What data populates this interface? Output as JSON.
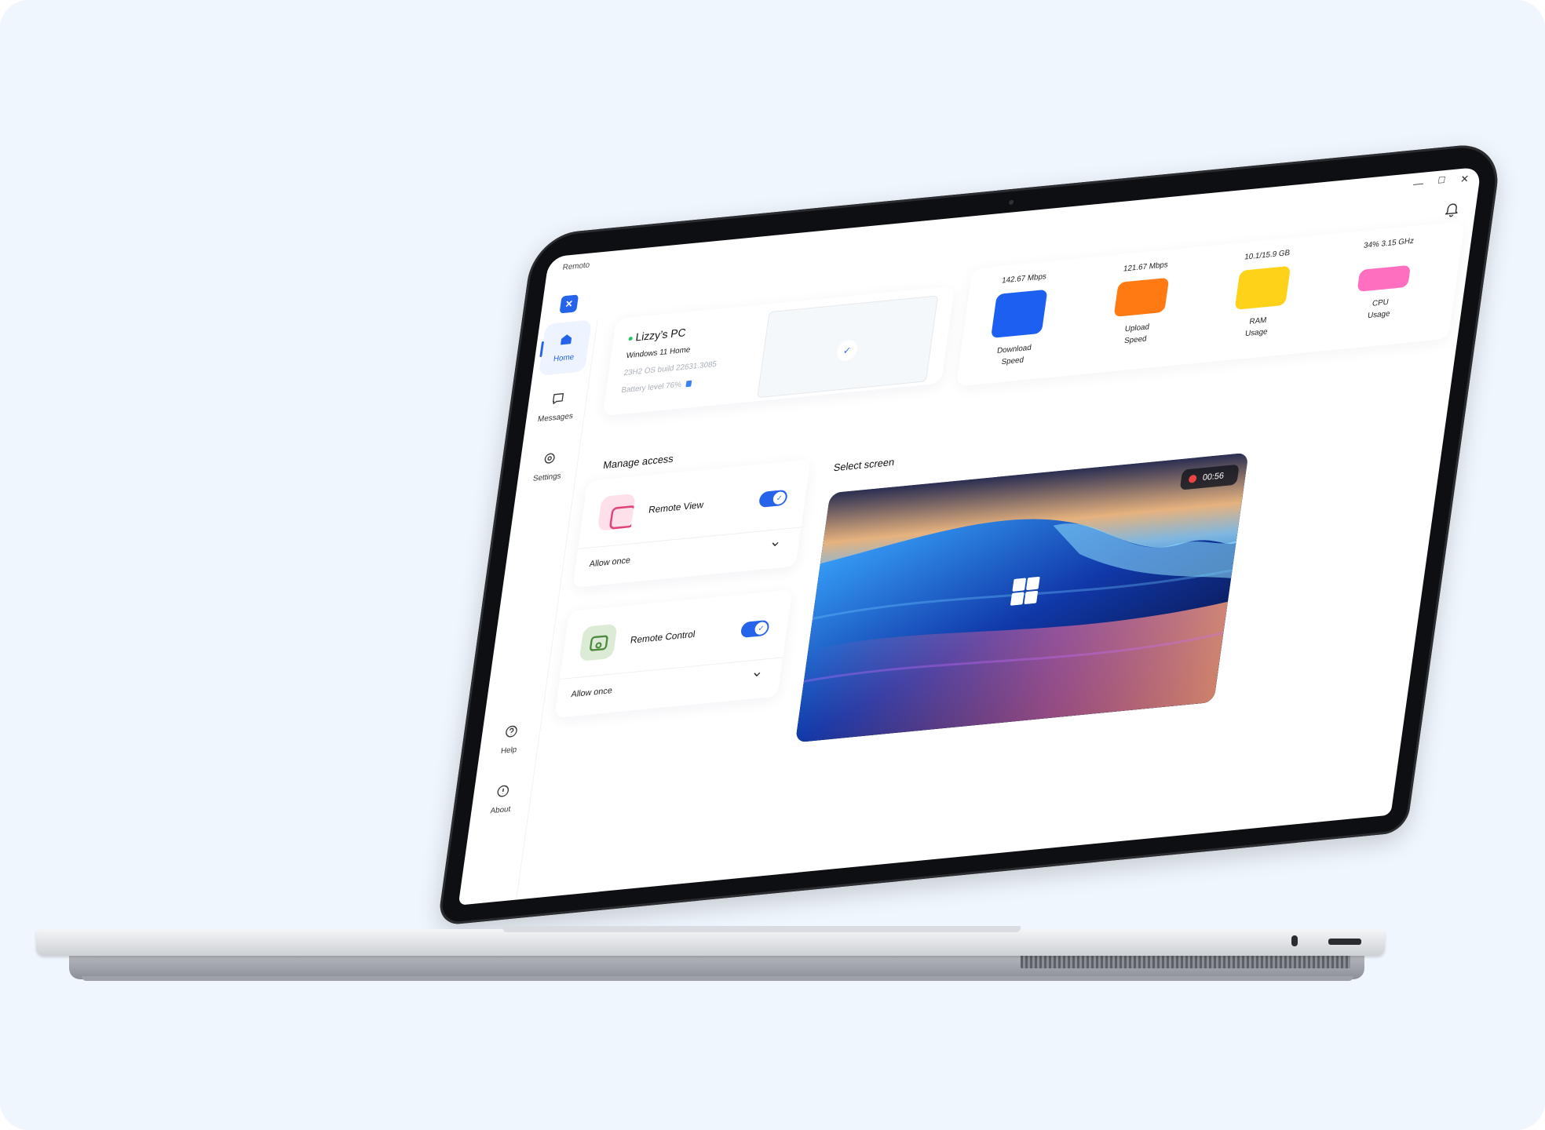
{
  "app": {
    "name": "Remoto",
    "logo_glyph": "✕"
  },
  "window_controls": {
    "minimize": "—",
    "maximize": "☐",
    "close": "✕"
  },
  "sidebar": {
    "items": [
      {
        "label": "Home",
        "icon": "home-icon",
        "active": true
      },
      {
        "label": "Messages",
        "icon": "message-icon"
      },
      {
        "label": "Settings",
        "icon": "gear-icon"
      }
    ],
    "bottom": [
      {
        "label": "Help",
        "icon": "help-icon"
      },
      {
        "label": "About",
        "icon": "info-icon"
      }
    ]
  },
  "pc": {
    "name": "Lizzy’s PC",
    "os": "Windows 11 Home",
    "build": "23H2 OS build 22631.3085",
    "battery": "Battery level 76%"
  },
  "metrics": [
    {
      "value": "142.67 Mbps",
      "label_line1": "Download",
      "label_line2": "Speed",
      "color": "#1d5ff0"
    },
    {
      "value": "121.67 Mbps",
      "label_line1": "Upload",
      "label_line2": "Speed",
      "color": "#ff7a12"
    },
    {
      "value": "10.1/15.9 GB",
      "label_line1": "RAM",
      "label_line2": "Usage",
      "color": "#ffd21a"
    },
    {
      "value": "34% 3.15 GHz",
      "label_line1": "CPU",
      "label_line2": "Usage",
      "color": "#ff6fc0"
    }
  ],
  "manage_access": {
    "title": "Manage access",
    "items": [
      {
        "title": "Remote View",
        "enabled": true,
        "select": "Allow once",
        "icon_bg": "#fde0ea",
        "icon_color": "#e0457a"
      },
      {
        "title": "Remote Control",
        "enabled": true,
        "select": "Allow once",
        "icon_bg": "#dcebd6",
        "icon_color": "#4c8a3e"
      }
    ]
  },
  "select_screen": {
    "title": "Select screen",
    "recording_time": "00:56"
  }
}
